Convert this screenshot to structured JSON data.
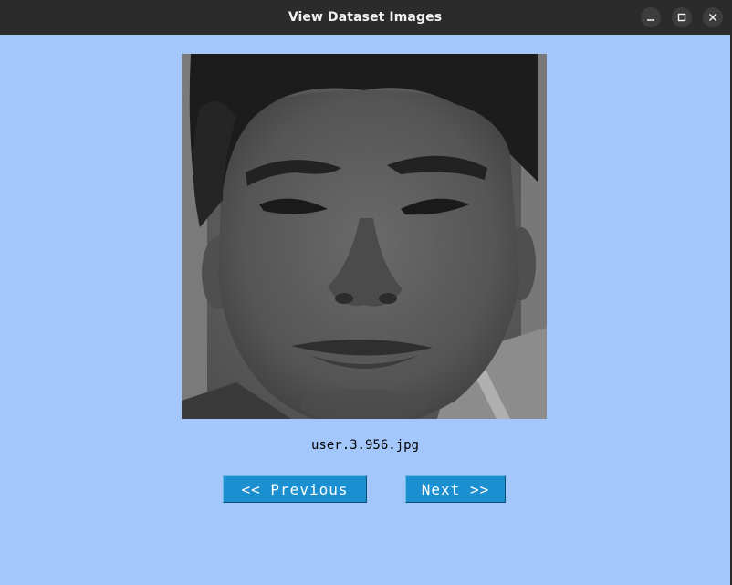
{
  "window": {
    "title": "View Dataset Images",
    "controls": {
      "minimize": "minimize-icon",
      "maximize": "maximize-icon",
      "close": "close-icon"
    }
  },
  "viewer": {
    "filename": "user.3.956.jpg",
    "previous_label": "<< Previous",
    "next_label": "Next >>"
  },
  "colors": {
    "background": "#a3c6fb",
    "titlebar": "#2b2b2b",
    "button": "#1b8fd0",
    "button_text": "#ffffff"
  }
}
